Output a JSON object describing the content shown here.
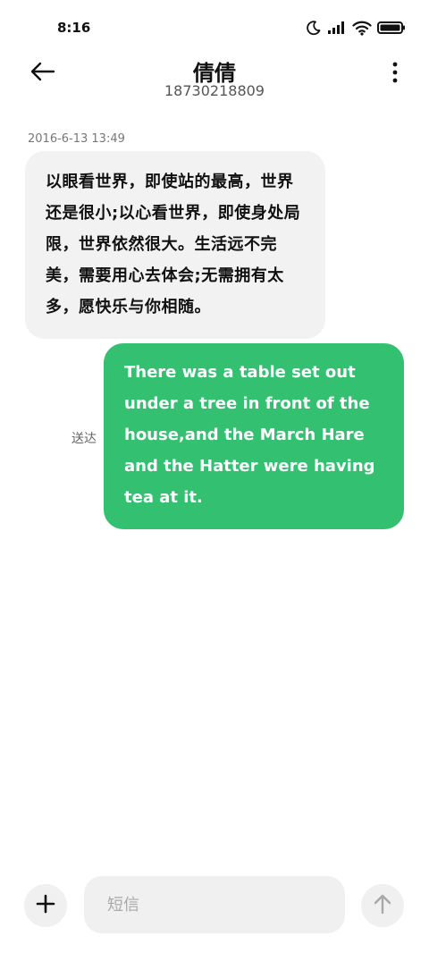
{
  "status_bar": {
    "time": "8:16",
    "icons": [
      "moon-icon",
      "signal-icon",
      "wifi-icon",
      "battery-icon"
    ]
  },
  "header": {
    "contact_name": "倩倩",
    "contact_number": "18730218809",
    "back_icon": "arrow-left-icon",
    "more_icon": "more-vertical-icon"
  },
  "conversation": {
    "timestamp": "2016-6-13 13:49",
    "incoming": {
      "text": "以眼看世界，即使站的最高，世界还是很小;以心看世界，即使身处局限，世界依然很大。生活远不完美，需要用心去体会;无需拥有太多，愿快乐与你相随。"
    },
    "outgoing": {
      "text": "There was a table set out under a tree in front of the house,and the March Hare and the Hatter were having tea at it.",
      "status": "送达"
    }
  },
  "composer": {
    "placeholder": "短信",
    "value": "",
    "add_icon": "plus-icon",
    "send_icon": "arrow-up-icon"
  },
  "colors": {
    "outgoing_bubble": "#33c070",
    "incoming_bubble": "#f2f2f2",
    "input_background": "#f0f0f0"
  }
}
